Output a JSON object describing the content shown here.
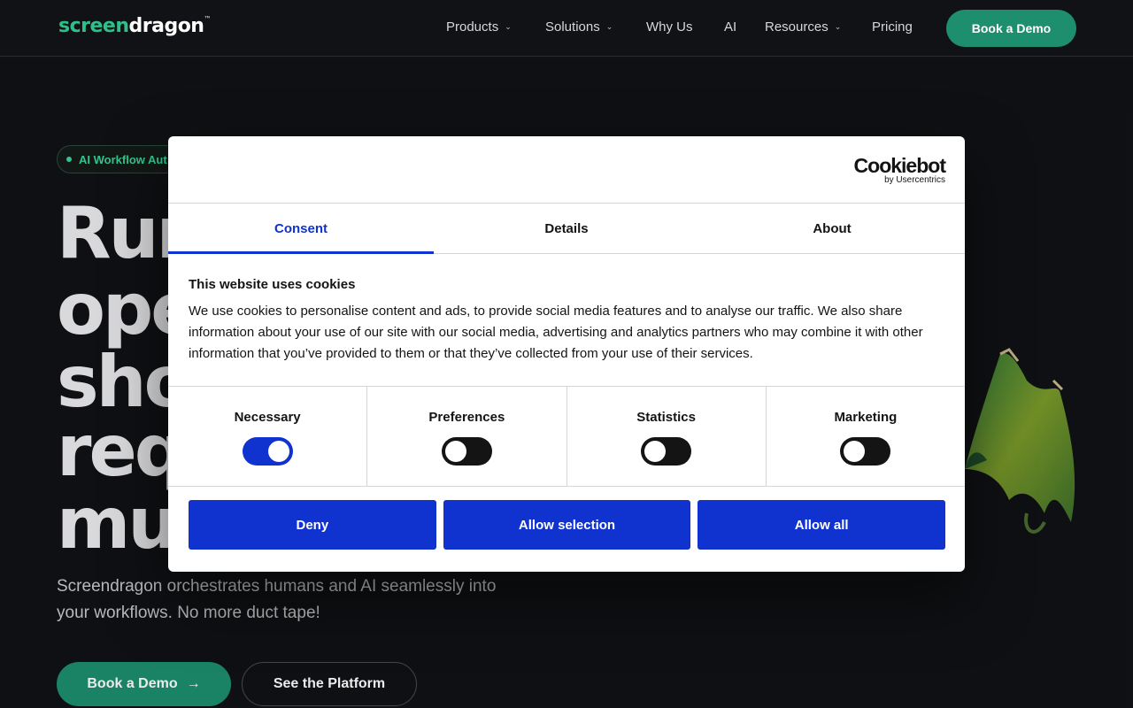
{
  "header": {
    "logo_green": "screen",
    "logo_white": "dragon",
    "logo_tm": "™",
    "nav": [
      {
        "label": "Products",
        "chevron": true
      },
      {
        "label": "Solutions",
        "chevron": true
      },
      {
        "label": "Why Us",
        "chevron": false
      },
      {
        "label": "AI",
        "chevron": false
      },
      {
        "label": "Resources",
        "chevron": true
      },
      {
        "label": "Pricing",
        "chevron": false
      }
    ],
    "cta": "Book a Demo"
  },
  "hero": {
    "badge": "AI Workflow Aut",
    "headline_lines": [
      "Rur",
      "ope",
      "sho",
      "req",
      "mu"
    ],
    "subtitle": "Screendragon orchestrates humans and AI seamlessly into your workflows. No more duct tape!",
    "primary_cta": "Book a Demo",
    "secondary_cta": "See the Platform"
  },
  "cookie_dialog": {
    "brand": "Cookiebot",
    "brand_sub": "by Usercentrics",
    "tabs": [
      {
        "label": "Consent",
        "active": true
      },
      {
        "label": "Details",
        "active": false
      },
      {
        "label": "About",
        "active": false
      }
    ],
    "heading": "This website uses cookies",
    "text": "We use cookies to personalise content and ads, to provide social media features and to analyse our traffic. We also share information about your use of our site with our social media, advertising and analytics partners who may combine it with other information that you’ve provided to them or that they’ve collected from your use of their services.",
    "categories": [
      {
        "label": "Necessary",
        "on": true
      },
      {
        "label": "Preferences",
        "on": false
      },
      {
        "label": "Statistics",
        "on": false
      },
      {
        "label": "Marketing",
        "on": false
      }
    ],
    "buttons": {
      "deny": "Deny",
      "allow_selection": "Allow selection",
      "allow_all": "Allow all"
    }
  },
  "colors": {
    "brand_green": "#1e8f6e",
    "cookie_blue": "#1032cf",
    "background": "#111215"
  }
}
